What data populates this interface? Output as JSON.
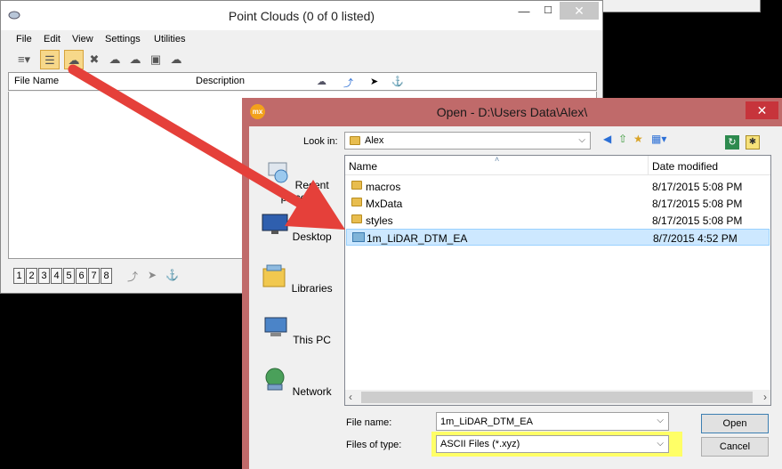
{
  "background_window": {
    "title": "Point Clouds (0 of 0 listed)",
    "menu": [
      "File",
      "Edit",
      "View",
      "Settings",
      "Utilities"
    ],
    "columns": [
      "File Name",
      "Description"
    ],
    "pages": [
      "1",
      "2",
      "3",
      "4",
      "5",
      "6",
      "7",
      "8"
    ]
  },
  "dialog": {
    "title": "Open - D:\\Users Data\\Alex\\",
    "app_icon_text": "mx",
    "look_in_label": "Look in:",
    "look_in_value": "Alex",
    "places": [
      "Recent places",
      "Desktop",
      "Libraries",
      "This PC",
      "Network"
    ],
    "columns": {
      "name": "Name",
      "date": "Date modified"
    },
    "files": [
      {
        "name": "macros",
        "date": "8/17/2015 5:08 PM",
        "type": "folder"
      },
      {
        "name": "MxData",
        "date": "8/17/2015 5:08 PM",
        "type": "folder"
      },
      {
        "name": "styles",
        "date": "8/17/2015 5:08 PM",
        "type": "folder"
      },
      {
        "name": "1m_LiDAR_DTM_EA",
        "date": "8/7/2015 4:52 PM",
        "type": "file",
        "selected": true
      }
    ],
    "file_name_label": "File name:",
    "file_name_value": "1m_LiDAR_DTM_EA",
    "files_of_type_label": "Files of type:",
    "files_of_type_value": "ASCII Files (*.xyz)",
    "open_label": "Open",
    "cancel_label": "Cancel"
  },
  "colors": {
    "dialog_frame": "#c06a6a",
    "close_button": "#c7343b",
    "arrow": "#e5403a",
    "highlight": "#ffff66",
    "selection": "#cde8ff"
  }
}
